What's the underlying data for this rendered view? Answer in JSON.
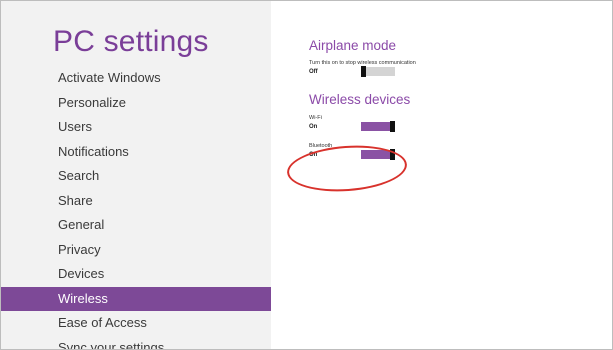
{
  "sidebar": {
    "title": "PC settings",
    "items": [
      {
        "label": "Activate Windows"
      },
      {
        "label": "Personalize"
      },
      {
        "label": "Users"
      },
      {
        "label": "Notifications"
      },
      {
        "label": "Search"
      },
      {
        "label": "Share"
      },
      {
        "label": "General"
      },
      {
        "label": "Privacy"
      },
      {
        "label": "Devices"
      },
      {
        "label": "Wireless",
        "selected": true
      },
      {
        "label": "Ease of Access"
      },
      {
        "label": "Sync your settings"
      }
    ]
  },
  "main": {
    "airplane": {
      "heading": "Airplane mode",
      "description": "Turn this on to stop wireless communication",
      "state": "Off"
    },
    "wireless": {
      "heading": "Wireless devices",
      "wifi": {
        "label": "Wi-Fi",
        "state": "On"
      },
      "bluetooth": {
        "label": "Bluetooth",
        "state": "On"
      }
    }
  },
  "colors": {
    "accent": "#7d4997",
    "annotation": "#d8322c"
  }
}
